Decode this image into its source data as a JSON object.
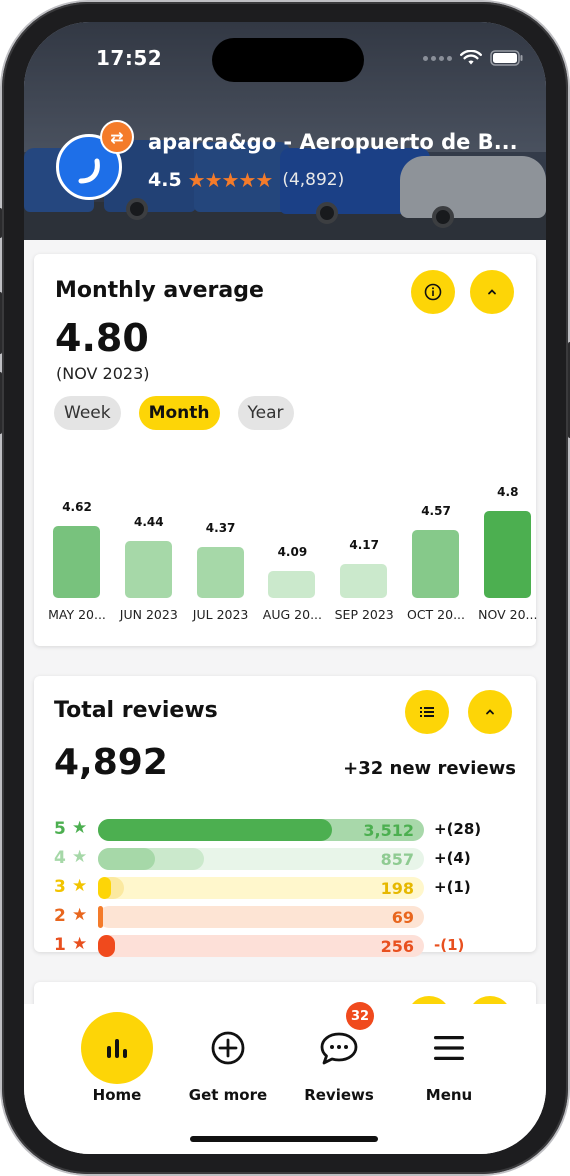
{
  "status_bar": {
    "time": "17:52"
  },
  "business": {
    "name": "aparca&go - Aeropuerto de B...",
    "rating": "4.5",
    "stars": "★★★★★",
    "review_count": "(4,892)"
  },
  "monthly_average": {
    "title": "Monthly average",
    "value": "4.80",
    "period": "(NOV 2023)",
    "tabs": [
      {
        "label": "Week",
        "active": false
      },
      {
        "label": "Month",
        "active": true
      },
      {
        "label": "Year",
        "active": false
      }
    ],
    "chart_data": {
      "type": "bar",
      "categories": [
        "MAY 20...",
        "JUN 2023",
        "JUL 2023",
        "AUG 20...",
        "SEP 2023",
        "OCT 20...",
        "NOV 20..."
      ],
      "values": [
        4.62,
        4.44,
        4.37,
        4.09,
        4.17,
        4.57,
        4.8
      ],
      "value_labels": [
        "4.62",
        "4.44",
        "4.37",
        "4.09",
        "4.17",
        "4.57",
        "4.8"
      ],
      "colors": [
        "#78c27d",
        "#a6d8a8",
        "#a6d8a8",
        "#cbe9cc",
        "#cbe9cc",
        "#86c98a",
        "#4caf50"
      ]
    }
  },
  "total_reviews": {
    "title": "Total reviews",
    "value": "4,892",
    "new_reviews": "+32 new reviews",
    "rows": [
      {
        "stars": "5",
        "count": "3,512",
        "delta": "+(28)",
        "fraction": 0.718,
        "color": "#4caf50",
        "track": "#a8d8aa",
        "text_color": "#4caf50",
        "star_color": "#4caf50"
      },
      {
        "stars": "4",
        "count": "857",
        "delta": "+(4)",
        "fraction": 0.175,
        "color": "#a6d8a8",
        "track": "#e8f5e9",
        "text_color": "#8fcb92",
        "star_color": "#a6d8a8"
      },
      {
        "stars": "3",
        "count": "198",
        "delta": "+(1)",
        "fraction": 0.04,
        "color": "#fdd507",
        "track": "#fff7cc",
        "text_color": "#e6b800",
        "star_color": "#f2c400"
      },
      {
        "stars": "2",
        "count": "69",
        "delta": "",
        "fraction": 0.014,
        "color": "#f47b2a",
        "track": "#fde4d4",
        "text_color": "#e8661e",
        "star_color": "#e8661e"
      },
      {
        "stars": "1",
        "count": "256",
        "delta": "-(1)",
        "fraction": 0.052,
        "color": "#f04a1d",
        "track": "#fde0d8",
        "text_color": "#e8501f",
        "star_color": "#e8501f"
      }
    ]
  },
  "nav": {
    "items": [
      {
        "label": "Home",
        "icon": "bar-chart-icon"
      },
      {
        "label": "Get more",
        "icon": "plus-circle-icon"
      },
      {
        "label": "Reviews",
        "icon": "chat-bubble-icon",
        "badge": "32"
      },
      {
        "label": "Menu",
        "icon": "hamburger-icon"
      }
    ]
  },
  "colors": {
    "accent": "#fdd507",
    "brand_blue": "#1e6fe8",
    "brand_orange": "#f47b2a"
  }
}
